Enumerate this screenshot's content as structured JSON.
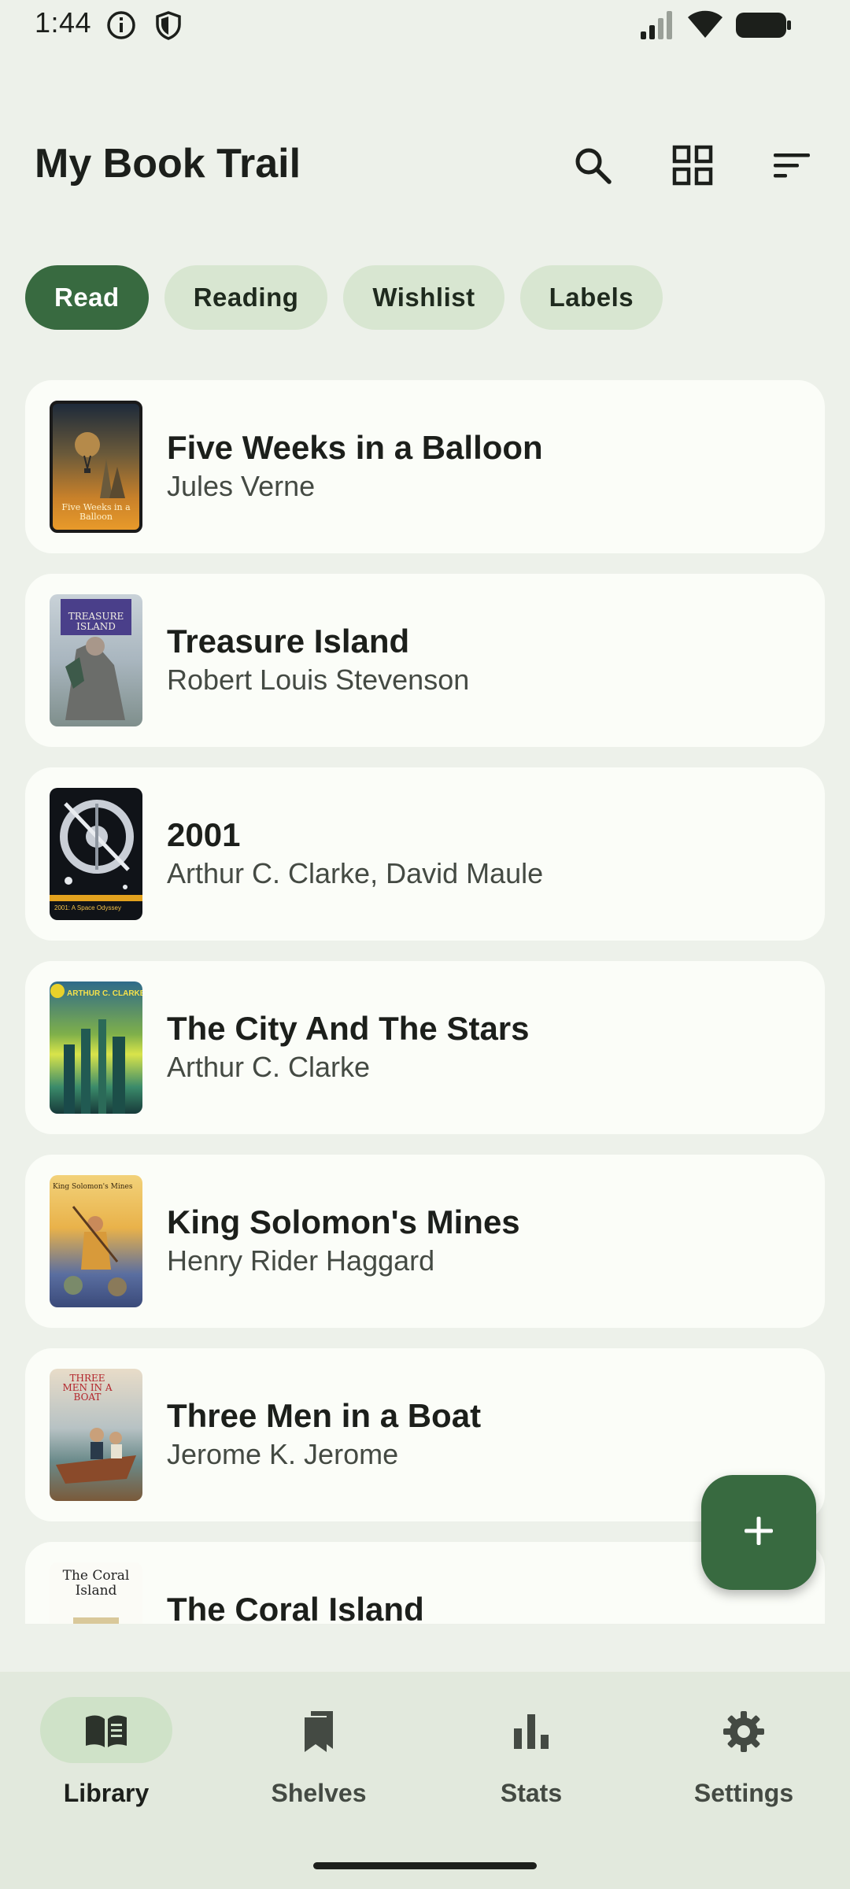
{
  "status_bar": {
    "time": "1:44"
  },
  "app_bar": {
    "title": "My Book Trail",
    "actions": [
      "search-icon",
      "grid-view-icon",
      "sort-icon"
    ]
  },
  "filter_chips": [
    {
      "label": "Read",
      "selected": true
    },
    {
      "label": "Reading",
      "selected": false
    },
    {
      "label": "Wishlist",
      "selected": false
    },
    {
      "label": "Labels",
      "selected": false
    }
  ],
  "books": [
    {
      "title": "Five Weeks in a Balloon",
      "author": "Jules Verne",
      "cover_text": "Five Weeks in a Balloon"
    },
    {
      "title": "Treasure Island",
      "author": "Robert Louis Stevenson",
      "cover_text": "TREASURE ISLAND"
    },
    {
      "title": "2001",
      "author": "Arthur C. Clarke, David Maule",
      "cover_text": "2001: A Space Odyssey"
    },
    {
      "title": "The City And The Stars",
      "author": "Arthur C. Clarke",
      "cover_text": "ARTHUR C. CLARKE"
    },
    {
      "title": "King Solomon's Mines",
      "author": "Henry Rider Haggard",
      "cover_text": "King Solomon's Mines"
    },
    {
      "title": "Three Men in a Boat",
      "author": "Jerome K. Jerome",
      "cover_text": "THREE MEN IN A BOAT"
    },
    {
      "title": "The Coral Island",
      "author": "",
      "cover_text": "The Coral Island"
    }
  ],
  "fab": {
    "icon": "add-icon"
  },
  "bottom_nav": [
    {
      "label": "Library",
      "icon": "book-open-icon",
      "active": true
    },
    {
      "label": "Shelves",
      "icon": "bookmark-icon",
      "active": false
    },
    {
      "label": "Stats",
      "icon": "bar-chart-icon",
      "active": false
    },
    {
      "label": "Settings",
      "icon": "gear-icon",
      "active": false
    }
  ],
  "colors": {
    "primary": "#386a40",
    "chip": "#d8e6d1",
    "background": "#edf1ea",
    "card": "#fbfdf8"
  }
}
